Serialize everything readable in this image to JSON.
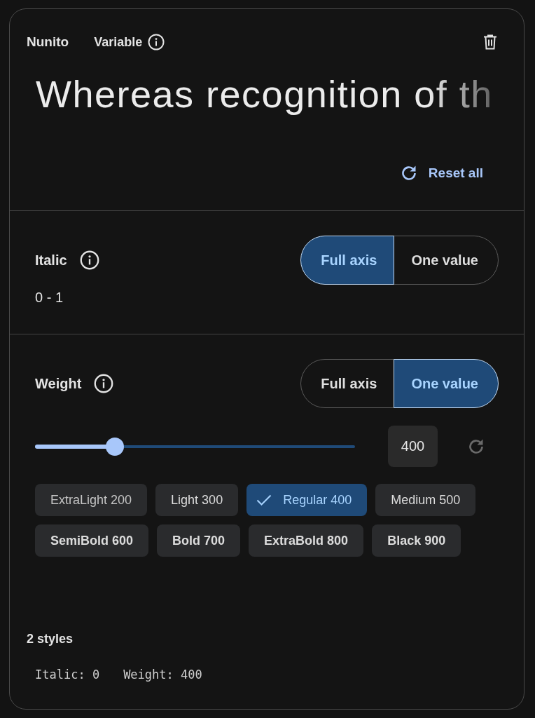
{
  "header": {
    "font_name": "Nunito",
    "type_label": "Variable"
  },
  "preview": {
    "text": "Whereas recognition of th"
  },
  "reset_all": {
    "label": "Reset all"
  },
  "axes": [
    {
      "name": "Italic",
      "modes": [
        {
          "label": "Full axis",
          "selected": true
        },
        {
          "label": "One value",
          "selected": false
        }
      ],
      "range": "0 - 1"
    },
    {
      "name": "Weight",
      "modes": [
        {
          "label": "Full axis",
          "selected": false
        },
        {
          "label": "One value",
          "selected": true
        }
      ],
      "slider": {
        "level": 0.25
      },
      "value": "400",
      "reset": {
        "disabled": true
      },
      "instances": [
        {
          "label": "ExtraLight 200",
          "selected": false
        },
        {
          "label": "Light 300",
          "selected": false
        },
        {
          "label": "Regular 400",
          "selected": true
        },
        {
          "label": "Medium 500",
          "selected": false
        },
        {
          "label": "SemiBold 600",
          "selected": false
        },
        {
          "label": "Bold 700",
          "selected": false
        },
        {
          "label": "ExtraBold 800",
          "selected": false
        },
        {
          "label": "Black 900",
          "selected": false
        }
      ]
    }
  ],
  "summary": {
    "title": "2 styles",
    "values": [
      "Italic: 0",
      "Weight: 400"
    ]
  }
}
